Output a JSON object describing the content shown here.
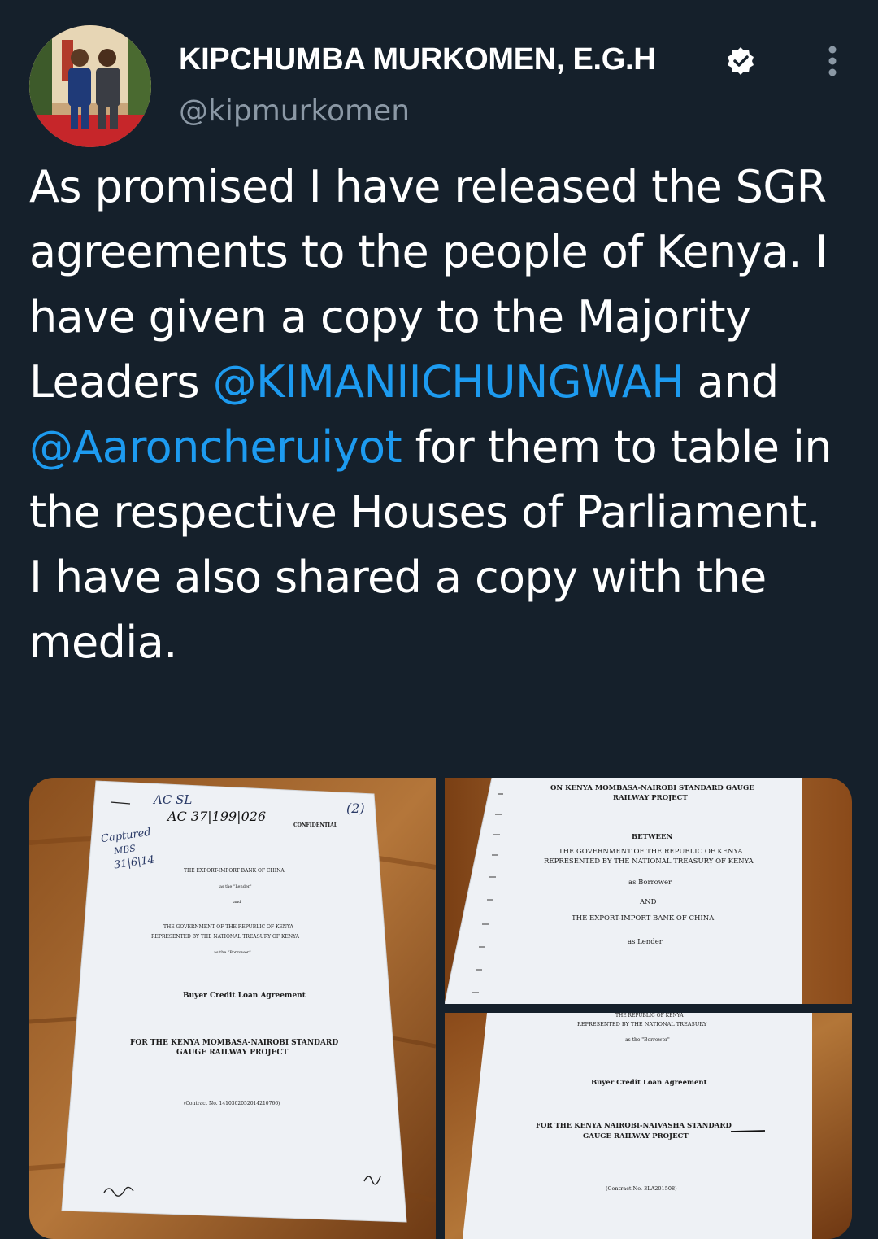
{
  "author": {
    "display_name": "KIPCHUMBA MURKOMEN, E.G.H",
    "handle": "@kipmurkomen",
    "verified_icon": "verified-badge-icon"
  },
  "tweet": {
    "text_before": "As promised I have released the SGR agreements to the people of Kenya. I have given a copy to the  Majority Leaders ",
    "mention_1": "@KIMANIICHUNGWAH",
    "text_middle": " and ",
    "mention_2": "@Aaroncheruiyot",
    "text_after": " for them to table in the respective Houses of Parliament. I have also shared a copy with the media."
  },
  "colors": {
    "background": "#15202b",
    "mention": "#1d9bf0",
    "secondary_text": "#8b98a5",
    "wood": "#a8692e"
  },
  "photo_1": {
    "handwritten_1": "AC  SL",
    "handwritten_2": "AC  37|199|026",
    "page_number": "(2)",
    "margin_note_1": "Captured",
    "margin_note_2": "MBS",
    "margin_note_3": "31|6|14",
    "confidential": "CONFIDENTIAL",
    "lender": "THE EXPORT-IMPORT BANK OF CHINA",
    "as_lender": "as the \"Lender\"",
    "and": "and",
    "government": "THE GOVERNMENT OF THE REPUBLIC OF KENYA",
    "represented": "REPRESENTED BY THE NATIONAL TREASURY OF KENYA",
    "as_borrower": "as the \"Borrower\"",
    "agreement": "Buyer Credit Loan Agreement",
    "project_1": "FOR THE KENYA MOMBASA-NAIROBI STANDARD",
    "project_2": "GAUGE RAILWAY PROJECT",
    "contract": "(Contract No. 1410302052014210766)"
  },
  "photo_2": {
    "title_1": "ON KENYA MOMBASA-NAIROBI STANDARD GAUGE",
    "title_2": "RAILWAY PROJECT",
    "between": "BETWEEN",
    "government": "THE GOVERNMENT OF THE REPUBLIC OF KENYA",
    "represented": "REPRESENTED BY THE NATIONAL TREASURY OF KENYA",
    "as_borrower": "as Borrower",
    "and": "AND",
    "lender": "THE EXPORT-IMPORT BANK OF CHINA",
    "as_lender": "as Lender"
  },
  "photo_3": {
    "header_1": "THE REPUBLIC OF KENYA",
    "header_2": "REPRESENTED BY THE NATIONAL TREASURY",
    "as_borrower": "as the \"Borrower\"",
    "agreement": "Buyer Credit Loan Agreement",
    "project_1": "FOR THE KENYA NAIROBI-NAIVASHA STANDARD",
    "project_2": "GAUGE RAILWAY PROJECT",
    "contract": "(Contract No. 3LA201508)"
  }
}
